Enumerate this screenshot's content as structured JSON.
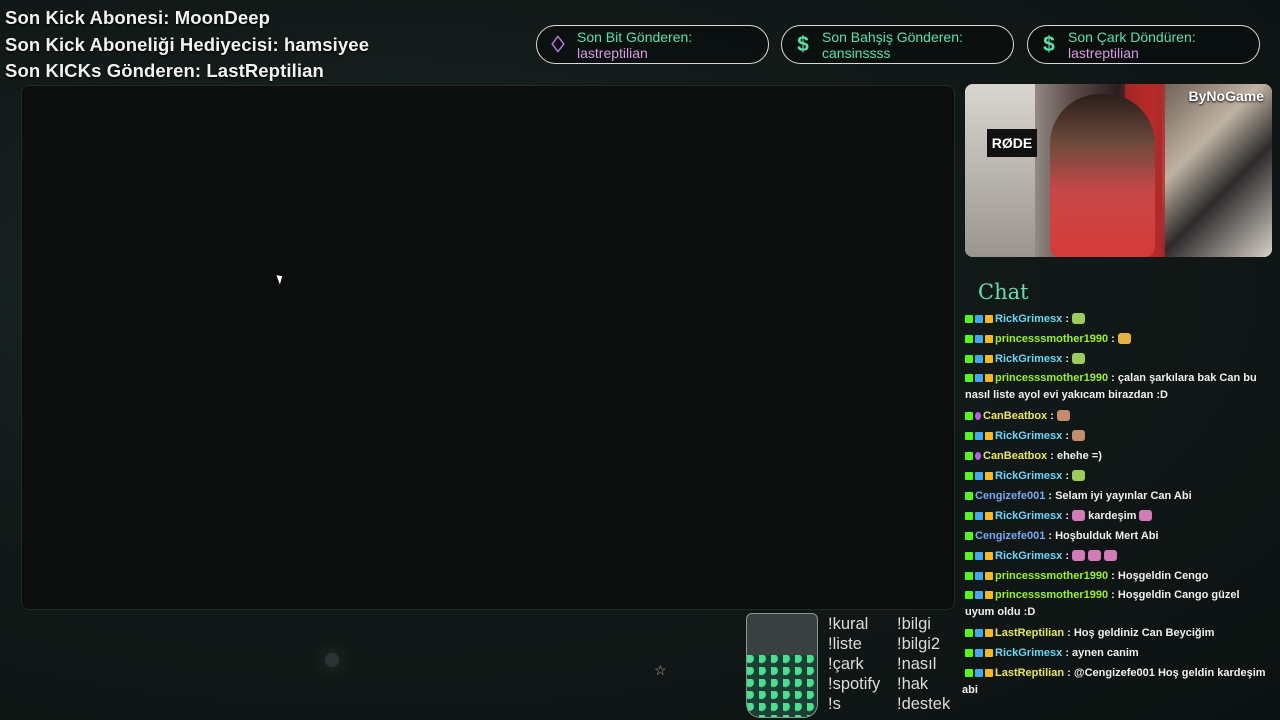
{
  "top_left": {
    "line1": "Son Kick Abonesi: MoonDeep",
    "line2": "Son Kick Aboneliği Hediyecisi: hamsiyee",
    "line3": "Son KICKs Gönderen: LastReptilian"
  },
  "pills": [
    {
      "icon": "diamond-icon",
      "label": "Son Bit Gönderen:",
      "value": "lastreptilian"
    },
    {
      "icon": "dollar-icon",
      "label": "Son Bahşiş Gönderen:",
      "value": "cansinssss"
    },
    {
      "icon": "dollar-icon",
      "label": "Son Çark Döndüren:",
      "value": "lastreptilian"
    }
  ],
  "webcam": {
    "brand": "ByNoGame",
    "mic_label": "RØDE"
  },
  "chat": {
    "title": "Chat",
    "messages": [
      {
        "user": "RickGrimesx",
        "text": " : "
      },
      {
        "user": "princesssmother1990",
        "text": " : "
      },
      {
        "user": "RickGrimesx",
        "text": " : "
      },
      {
        "user": "princesssmother1990",
        "text": " : çalan şarkılara bak Can bu nasıl liste ayol evi yakıcam birazdan :D"
      },
      {
        "user": "CanBeatbox",
        "text": " : "
      },
      {
        "user": "RickGrimesx",
        "text": " : "
      },
      {
        "user": "CanBeatbox",
        "text": " : ehehe =)"
      },
      {
        "user": "RickGrimesx",
        "text": " : "
      },
      {
        "user": "Cengizefe001",
        "text": " : Selam iyi yayınlar Can Abi"
      },
      {
        "user": "RickGrimesx",
        "text": " : "
      },
      {
        "user": "Cengizefe001",
        "text": " : Hoşbulduk Mert Abi"
      },
      {
        "user": "RickGrimesx",
        "text": " : "
      },
      {
        "user": "princesssmother1990",
        "text": " : Hoşgeldin Cengo"
      },
      {
        "user": "princesssmother1990",
        "text": " : Hoşgeldin Cango güzel uyum oldu :D"
      },
      {
        "user": "LastReptilian",
        "text": " : Hoş geldiniz Can Beyciğim"
      },
      {
        "user": "RickGrimesx",
        "text": " : aynen canim"
      },
      {
        "user": "LastReptilian",
        "text": " : @Cengizefe001 Hoş geldin kardeşim"
      }
    ],
    "extra_text": "kardeşim",
    "overflow_text": "abi"
  },
  "commands": {
    "col1": [
      "!kural",
      "!liste",
      "!çark",
      "!spotify",
      "!s"
    ],
    "col2": [
      "!bilgi",
      "!bilgi2",
      "!nasıl",
      "!hak",
      "!destek"
    ]
  },
  "colors": {
    "accent": "#55e3a8",
    "pink": "#d99adf",
    "background": "#121a19"
  }
}
